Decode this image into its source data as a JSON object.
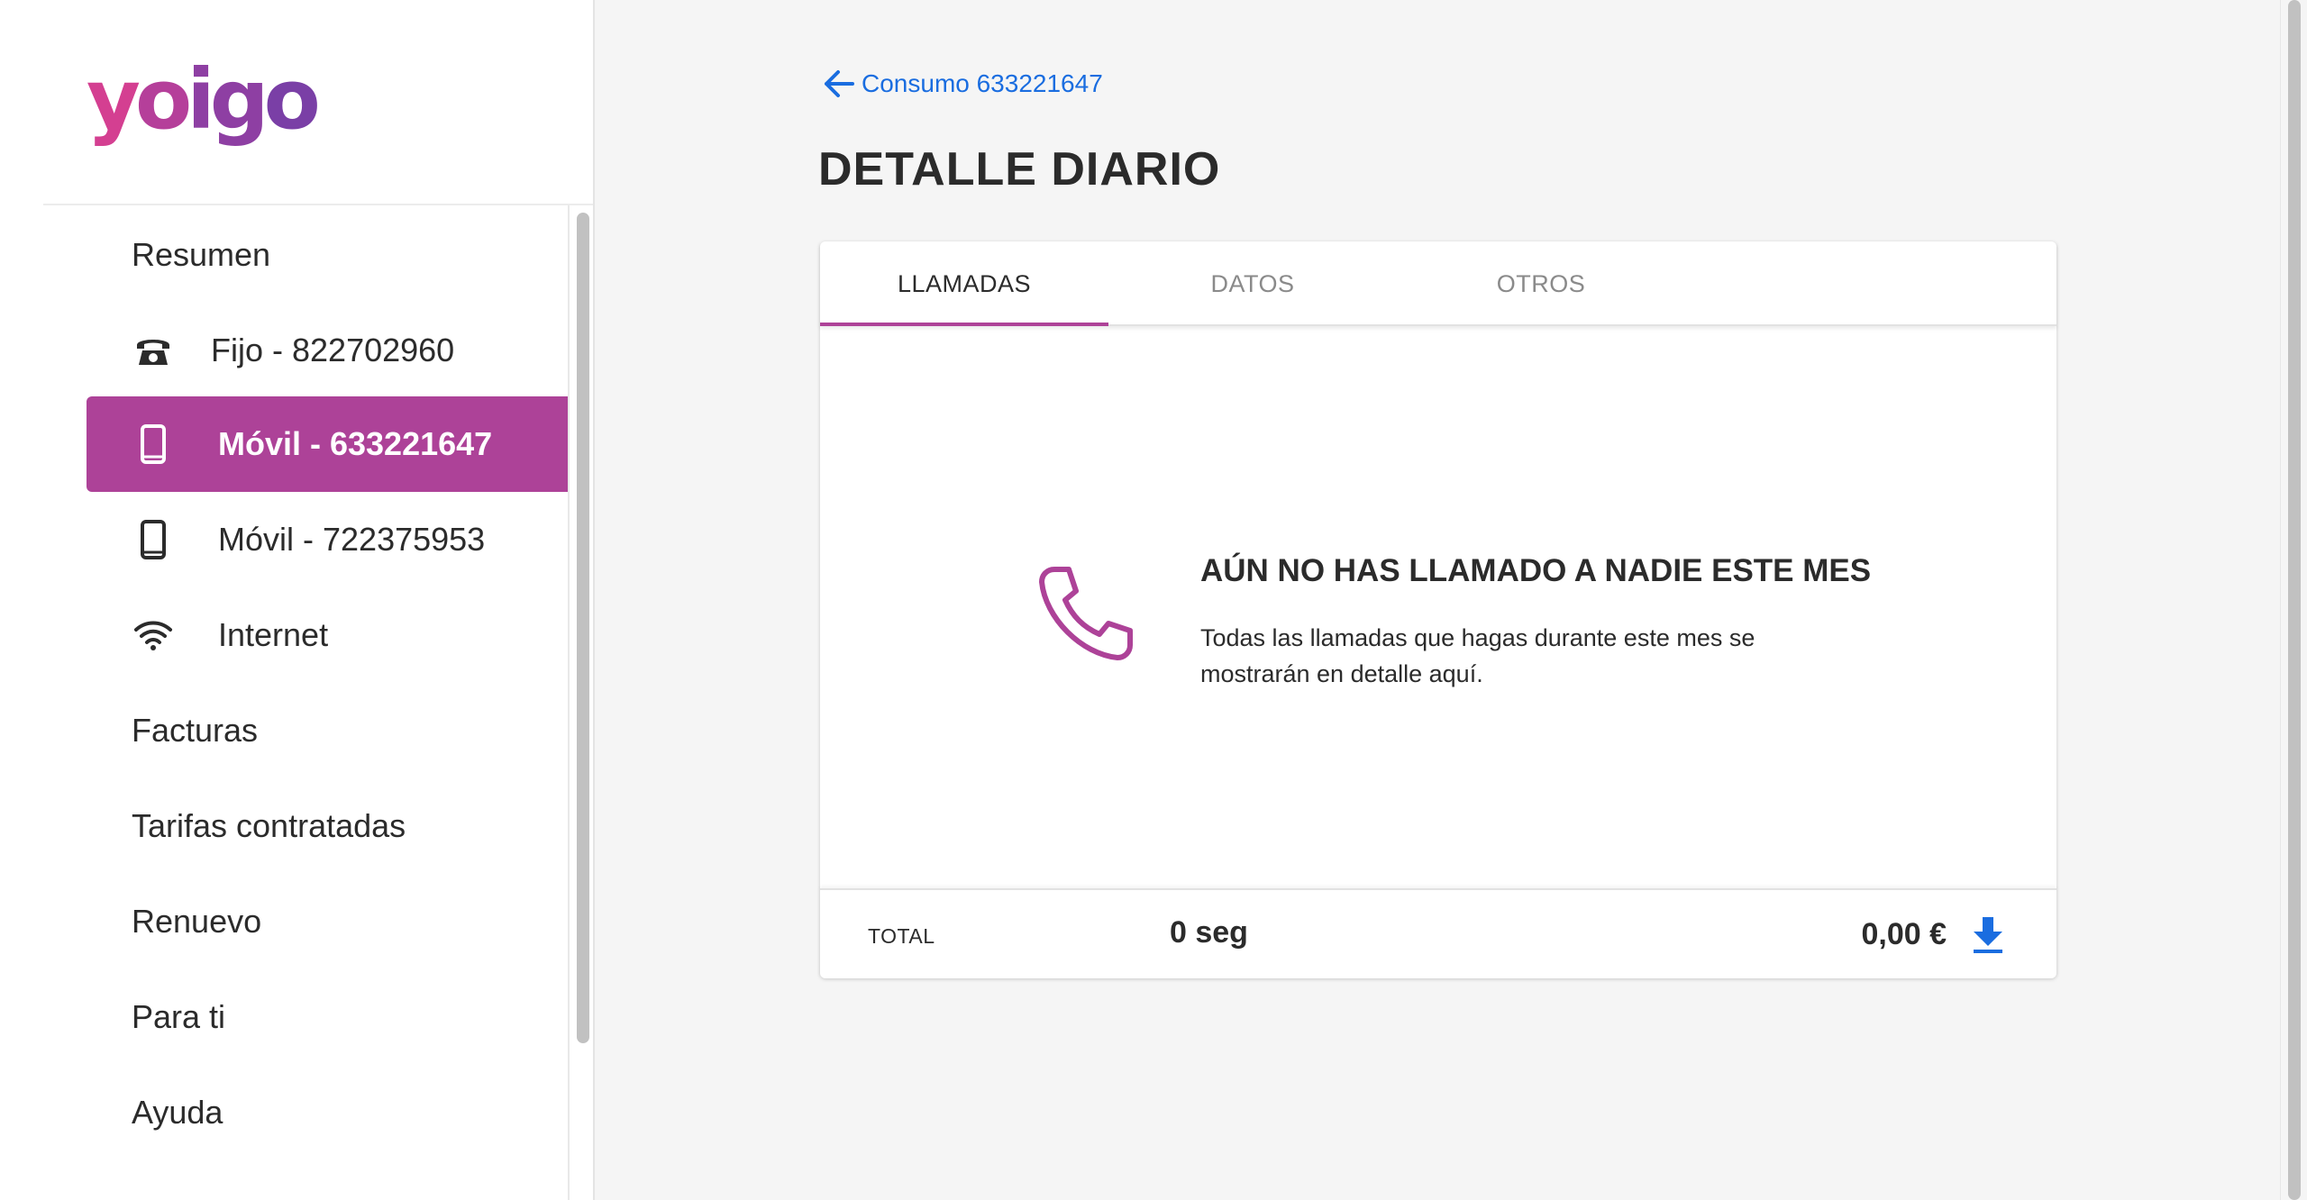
{
  "brand": {
    "logo_text": "yoigo",
    "accent_color": "#ad4298",
    "link_color": "#1a6de0"
  },
  "sidebar": {
    "items": [
      {
        "label": "Resumen"
      },
      {
        "label": "Fijo - 822702960",
        "icon": "landline-phone-icon"
      },
      {
        "label": "Móvil - 633221647",
        "icon": "mobile-phone-icon",
        "active": true
      },
      {
        "label": "Móvil - 722375953",
        "icon": "mobile-phone-icon"
      },
      {
        "label": "Internet",
        "icon": "wifi-icon"
      },
      {
        "label": "Facturas"
      },
      {
        "label": "Tarifas contratadas"
      },
      {
        "label": "Renuevo"
      },
      {
        "label": "Para ti"
      },
      {
        "label": "Ayuda"
      }
    ]
  },
  "header": {
    "back_link": "Consumo 633221647",
    "title": "DETALLE DIARIO"
  },
  "tabs": [
    {
      "label": "LLAMADAS",
      "active": true
    },
    {
      "label": "DATOS"
    },
    {
      "label": "OTROS"
    }
  ],
  "empty_state": {
    "icon": "phone-icon",
    "title": "AÚN NO HAS LLAMADO A NADIE ESTE MES",
    "description": "Todas las llamadas que hagas durante este mes se mostrarán en detalle aquí."
  },
  "totals": {
    "label": "TOTAL",
    "duration": "0 seg",
    "amount": "0,00 €",
    "download_icon": "download-icon"
  }
}
